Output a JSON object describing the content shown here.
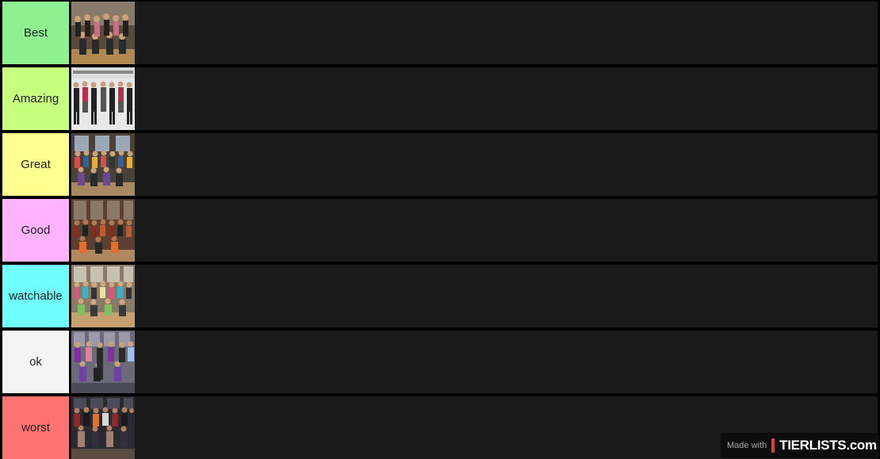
{
  "tiers": [
    {
      "label": "Best",
      "color": "#8ff08f"
    },
    {
      "label": "Amazing",
      "color": "#c7ff7f"
    },
    {
      "label": "Great",
      "color": "#ffff8f"
    },
    {
      "label": "Good",
      "color": "#ffb3ff"
    },
    {
      "label": "watchable",
      "color": "#70ffff"
    },
    {
      "label": "ok",
      "color": "#f4f4f4"
    },
    {
      "label": "worst",
      "color": "#ff7272"
    }
  ],
  "watermark": {
    "made_with": "Made with",
    "logo": "TIERLISTS.com"
  }
}
